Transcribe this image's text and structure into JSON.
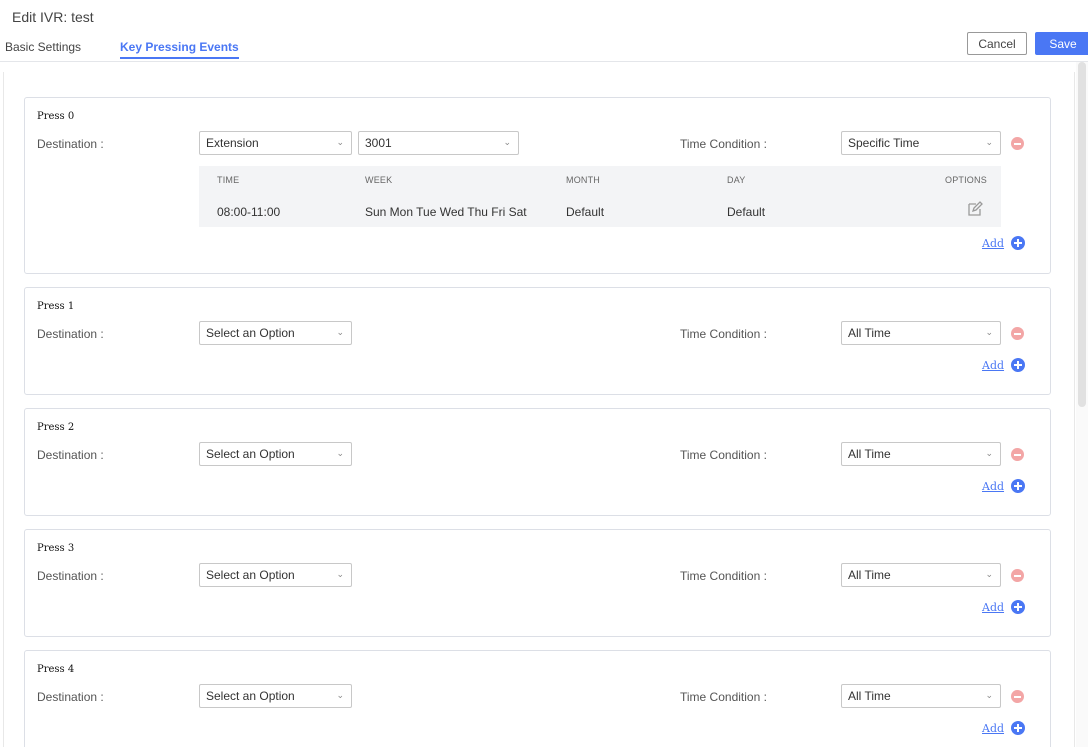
{
  "header": {
    "title": "Edit IVR: test",
    "cancel_label": "Cancel",
    "save_label": "Save"
  },
  "tabs": [
    {
      "label": "Basic Settings",
      "active": false
    },
    {
      "label": "Key Pressing Events",
      "active": true
    }
  ],
  "labels": {
    "destination": "Destination :",
    "time_condition": "Time Condition :",
    "add": "Add"
  },
  "colors": {
    "accent": "#4a77f4",
    "remove": "#f3a6a6"
  },
  "icons": {
    "remove": "minus-circle-icon",
    "add": "plus-circle-icon",
    "edit": "edit-icon",
    "dropdown": "chevron-down-icon"
  },
  "events": [
    {
      "title": "Press 0",
      "destination": "Extension",
      "extension": "3001",
      "time_condition": "Specific Time",
      "time_table": {
        "headers": [
          "TIME",
          "WEEK",
          "MONTH",
          "DAY",
          "OPTIONS"
        ],
        "rows": [
          {
            "time": "08:00-11:00",
            "week": "Sun Mon Tue Wed Thu Fri Sat",
            "month": "Default",
            "day": "Default"
          }
        ]
      }
    },
    {
      "title": "Press 1",
      "destination": "Select an Option",
      "time_condition": "All Time"
    },
    {
      "title": "Press 2",
      "destination": "Select an Option",
      "time_condition": "All Time"
    },
    {
      "title": "Press 3",
      "destination": "Select an Option",
      "time_condition": "All Time"
    },
    {
      "title": "Press 4",
      "destination": "Select an Option",
      "time_condition": "All Time"
    }
  ]
}
